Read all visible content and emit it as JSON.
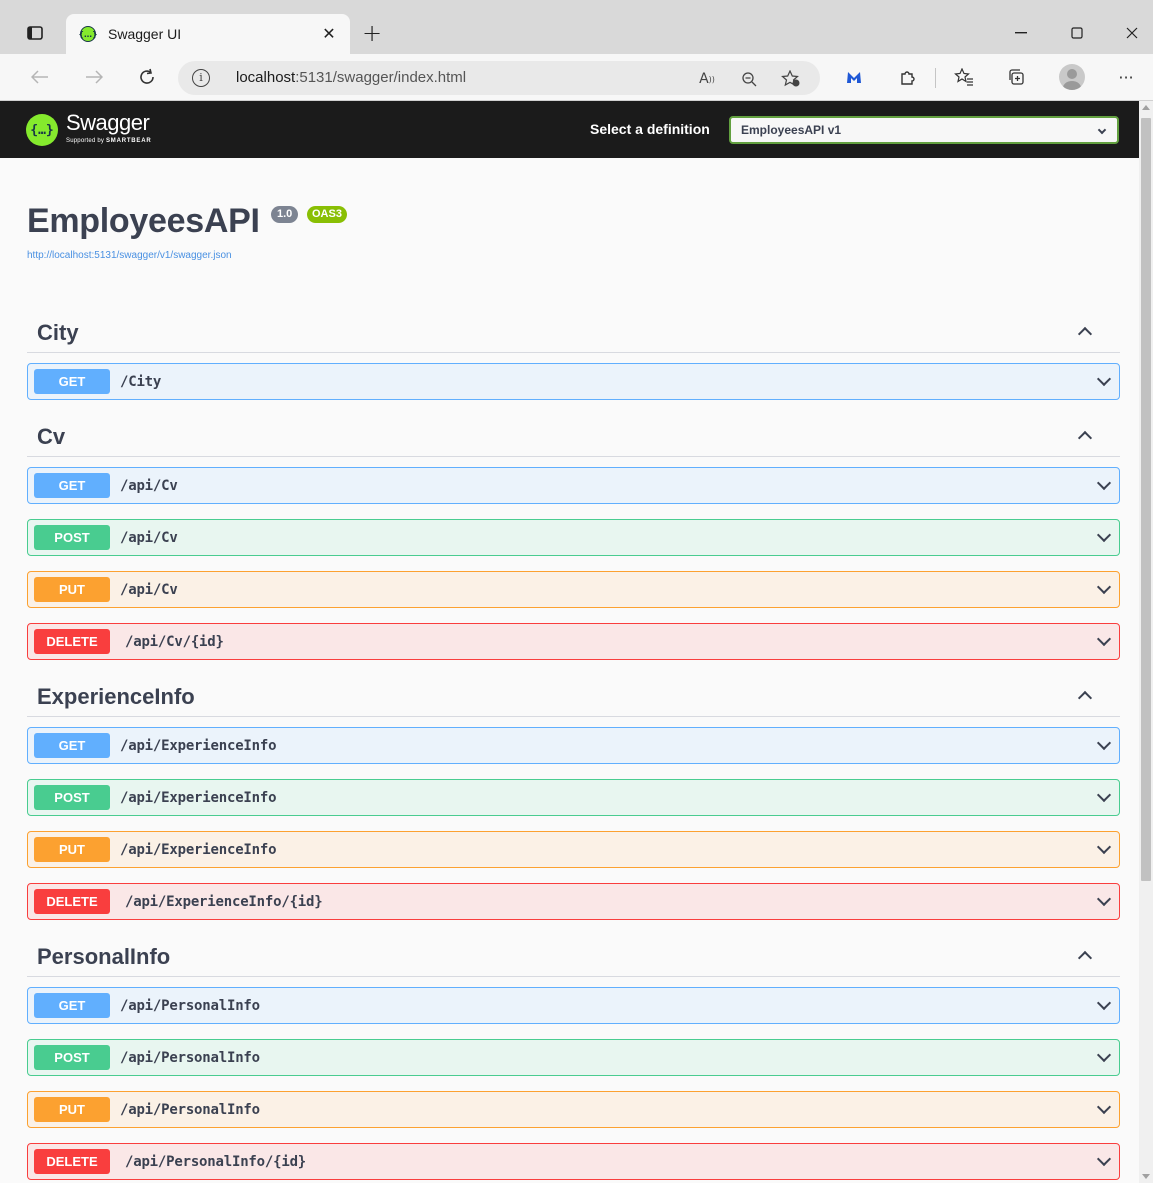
{
  "browser": {
    "tab_title": "Swagger UI",
    "new_tab": "+",
    "url_host": "localhost",
    "url_rest": ":5131/swagger/index.html"
  },
  "swagger": {
    "brand": "Swagger",
    "brand_sub_prefix": "Supported by ",
    "brand_sub_company": "SMARTBEAR",
    "logo_glyph": "{…}",
    "definition_label": "Select a definition",
    "definition_value": "EmployeesAPI v1"
  },
  "info": {
    "title": "EmployeesAPI",
    "version": "1.0",
    "oas": "OAS3",
    "spec_url": "http://localhost:5131/swagger/v1/swagger.json"
  },
  "sections": [
    {
      "name": "City",
      "ops": [
        {
          "method": "GET",
          "path": "/City"
        }
      ]
    },
    {
      "name": "Cv",
      "ops": [
        {
          "method": "GET",
          "path": "/api/Cv"
        },
        {
          "method": "POST",
          "path": "/api/Cv"
        },
        {
          "method": "PUT",
          "path": "/api/Cv"
        },
        {
          "method": "DELETE",
          "path": "/api/Cv/{id}"
        }
      ]
    },
    {
      "name": "ExperienceInfo",
      "ops": [
        {
          "method": "GET",
          "path": "/api/ExperienceInfo"
        },
        {
          "method": "POST",
          "path": "/api/ExperienceInfo"
        },
        {
          "method": "PUT",
          "path": "/api/ExperienceInfo"
        },
        {
          "method": "DELETE",
          "path": "/api/ExperienceInfo/{id}"
        }
      ]
    },
    {
      "name": "PersonalInfo",
      "ops": [
        {
          "method": "GET",
          "path": "/api/PersonalInfo"
        },
        {
          "method": "POST",
          "path": "/api/PersonalInfo"
        },
        {
          "method": "PUT",
          "path": "/api/PersonalInfo"
        },
        {
          "method": "DELETE",
          "path": "/api/PersonalInfo/{id}"
        }
      ]
    }
  ],
  "colors": {
    "get": "#61affe",
    "post": "#49cc90",
    "put": "#fca130",
    "delete": "#f93e3e",
    "swagger_green": "#85ea2d",
    "topbar": "#1b1b1b"
  },
  "icons": {
    "tab_actions": "tab-actions-icon",
    "favicon": "swagger-favicon-icon",
    "close": "close-icon",
    "back": "back-arrow-icon",
    "forward": "forward-arrow-icon",
    "refresh": "refresh-icon",
    "info": "info-icon",
    "read_aloud": "read-aloud-icon",
    "zoom": "zoom-out-icon",
    "add_favorite": "add-favorite-icon",
    "extension_m": "malwarebytes-extension-icon",
    "extensions": "extensions-icon",
    "favorites": "favorites-icon",
    "collections": "collections-icon",
    "profile": "profile-avatar-icon",
    "more": "more-menu-icon"
  }
}
